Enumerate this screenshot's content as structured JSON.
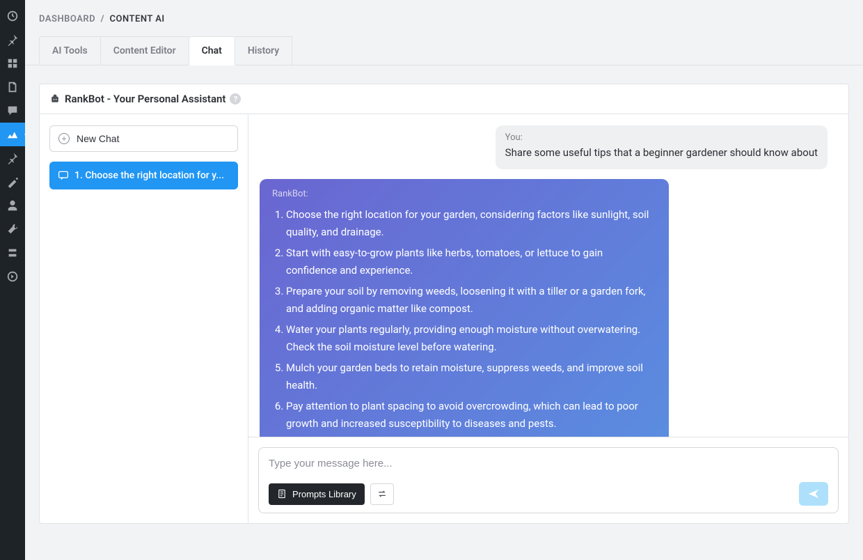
{
  "breadcrumb": {
    "root": "DASHBOARD",
    "sep": "/",
    "current": "CONTENT AI"
  },
  "tabs": [
    {
      "label": "AI Tools",
      "active": false
    },
    {
      "label": "Content Editor",
      "active": false
    },
    {
      "label": "Chat",
      "active": true
    },
    {
      "label": "History",
      "active": false
    }
  ],
  "panel": {
    "title": "RankBot - Your Personal Assistant"
  },
  "sidebar": {
    "new_chat_label": "New Chat",
    "chats": [
      {
        "label": "1. Choose the right location for y..."
      }
    ]
  },
  "conversation": {
    "user": {
      "who": "You:",
      "text": "Share some useful tips that a beginner gardener should know about"
    },
    "bot": {
      "who": "RankBot:",
      "items": [
        "Choose the right location for your garden, considering factors like sunlight, soil quality, and drainage.",
        "Start with easy-to-grow plants like herbs, tomatoes, or lettuce to gain confidence and experience.",
        "Prepare your soil by removing weeds, loosening it with a tiller or a garden fork, and adding organic matter like compost.",
        "Water your plants regularly, providing enough moisture without overwatering. Check the soil moisture level before watering.",
        "Mulch your garden beds to retain moisture, suppress weeds, and improve soil health.",
        "Pay attention to plant spacing to avoid overcrowding, which can lead to poor growth and increased susceptibility to diseases and pests."
      ]
    }
  },
  "compose": {
    "placeholder": "Type your message here...",
    "prompts_label": "Prompts Library"
  }
}
